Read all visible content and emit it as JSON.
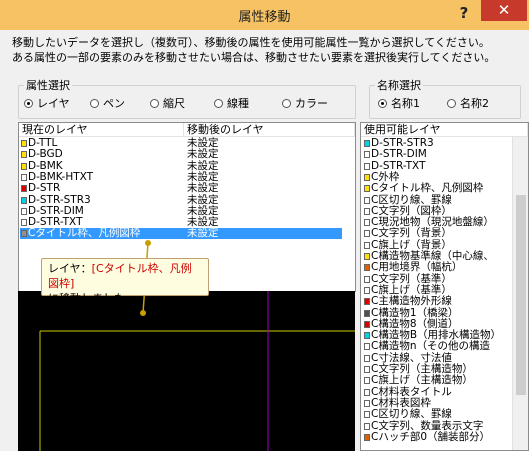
{
  "window": {
    "title": "属性移動",
    "help_label": "?",
    "close_label": "✕"
  },
  "instructions": [
    "移動したいデータを選択し（複数可）、移動後の属性を使用可能属性一覧から選択してください。",
    "ある属性の一部の要素のみを移動させたい場合は、移動させたい要素を選択後実行してください。"
  ],
  "attr_group": {
    "legend": "属性選択",
    "options": [
      {
        "label": "レイヤ",
        "checked": true
      },
      {
        "label": "ペン",
        "checked": false
      },
      {
        "label": "縮尺",
        "checked": false
      },
      {
        "label": "線種",
        "checked": false
      },
      {
        "label": "カラー",
        "checked": false
      }
    ]
  },
  "name_group": {
    "legend": "名称選択",
    "options": [
      {
        "label": "名称1",
        "checked": true
      },
      {
        "label": "名称2",
        "checked": false
      }
    ]
  },
  "layer_table": {
    "col_current": "現在のレイヤ",
    "col_after": "移動後のレイヤ",
    "rows": [
      {
        "name": "D-TTL",
        "after": "未設定",
        "color": "#ffe000",
        "selected": false
      },
      {
        "name": "D-BGD",
        "after": "未設定",
        "color": "#ffe000",
        "selected": false
      },
      {
        "name": "D-BMK",
        "after": "未設定",
        "color": "#ffe000",
        "selected": false
      },
      {
        "name": "D-BMK-HTXT",
        "after": "未設定",
        "color": "#ffffff",
        "selected": false
      },
      {
        "name": "D-STR",
        "after": "未設定",
        "color": "#e00000",
        "selected": false
      },
      {
        "name": "D-STR-STR3",
        "after": "未設定",
        "color": "#00d0e0",
        "selected": false
      },
      {
        "name": "D-STR-DIM",
        "after": "未設定",
        "color": "#ffffff",
        "selected": false
      },
      {
        "name": "D-STR-TXT",
        "after": "未設定",
        "color": "#ffffff",
        "selected": false
      },
      {
        "name": "Cタイトル枠、凡例図枠",
        "after": "未設定",
        "color": "#909090",
        "selected": true
      }
    ]
  },
  "available_list": {
    "header": "使用可能レイヤ",
    "items": [
      {
        "label": "D-STR-STR3",
        "color": "#00d0e0"
      },
      {
        "label": "D-STR-DIM",
        "color": "#ffffff"
      },
      {
        "label": "D-STR-TXT",
        "color": "#ffffff"
      },
      {
        "label": "C外枠",
        "color": "#ffe000"
      },
      {
        "label": "Cタイトル枠、凡例図枠",
        "color": "#ffe000"
      },
      {
        "label": "C区切り線、罫線",
        "color": "#ffffff"
      },
      {
        "label": "C文字列（図枠）",
        "color": "#ffffff"
      },
      {
        "label": "C現況地物（現況地盤線）",
        "color": "#ffffff"
      },
      {
        "label": "C文字列（背景）",
        "color": "#ffffff"
      },
      {
        "label": "C旗上げ（背景）",
        "color": "#ffffff"
      },
      {
        "label": "C構造物基準線（中心線、",
        "color": "#ffe000"
      },
      {
        "label": "C用地境界（幅杭）",
        "color": "#e06000"
      },
      {
        "label": "C文字列（基準）",
        "color": "#ffffff"
      },
      {
        "label": "C旗上げ（基準）",
        "color": "#ffffff"
      },
      {
        "label": "C主構造物外形線",
        "color": "#e00000"
      },
      {
        "label": "C構造物1（橋梁）",
        "color": "#505050"
      },
      {
        "label": "C構造物8（側道）",
        "color": "#e00000"
      },
      {
        "label": "C構造物B（用排水構造物）",
        "color": "#00d0e0"
      },
      {
        "label": "C構造物n（その他の構造",
        "color": "#ffffff"
      },
      {
        "label": "C寸法線、寸法値",
        "color": "#ffffff"
      },
      {
        "label": "C文字列（主構造物）",
        "color": "#ffffff"
      },
      {
        "label": "C旗上げ（主構造物）",
        "color": "#ffffff"
      },
      {
        "label": "C材料表タイトル",
        "color": "#ffffff"
      },
      {
        "label": "C材料表図枠",
        "color": "#ffffff"
      },
      {
        "label": "C区切り線、罫線",
        "color": "#ffffff"
      },
      {
        "label": "C文字列、数量表示文字",
        "color": "#ffffff"
      },
      {
        "label": "Cハッチ部0（舗装部分）",
        "color": "#e06000"
      }
    ]
  },
  "tooltip": {
    "prefix": "レイヤ：",
    "layer": "[Cタイトル枠、凡例図枠]",
    "suffix": "に移動しました。"
  },
  "colors": {
    "accent": "#f6c264",
    "selection": "#3399ff",
    "close": "#c7392b"
  }
}
